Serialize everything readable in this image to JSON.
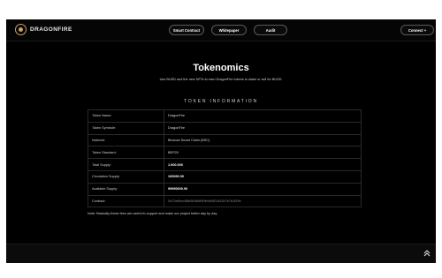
{
  "header": {
    "logo_text": "DRAGONFIRE",
    "nav": [
      "Smart Contract",
      "Whitepaper",
      "Audit"
    ],
    "connect_label": "Connect +"
  },
  "page": {
    "title": "Tokenomics",
    "subtitle": "Use BUSD and the new NFTs to earn DragonFire tokens to stake or sell for BUSD.",
    "section_title": "TOKEN INFORMATION"
  },
  "token_info": [
    {
      "label": "Token Name:",
      "value": "DragonFire"
    },
    {
      "label": "Token Symbole:",
      "value": "DragonFire"
    },
    {
      "label": "Network:",
      "value": "Binance Smart Chain (BSC)"
    },
    {
      "label": "Token Standard:",
      "value": "BEP20"
    },
    {
      "label": "Total Supply:",
      "value": "1.000.000"
    },
    {
      "label": "Circulation Supply:",
      "value": "100000.00"
    },
    {
      "label": "Available Supply:",
      "value": "99990000.00"
    },
    {
      "label": "Contract:",
      "value": "0xC0ef0ec4f8b5b3b5f0f9b9d0f21d22b7b7b1f29b"
    }
  ],
  "note": "Note: Basically these fees are useful to support and make our project better day by day.",
  "footer": {
    "scroll_top_icon": "chevron-double-up-icon"
  }
}
